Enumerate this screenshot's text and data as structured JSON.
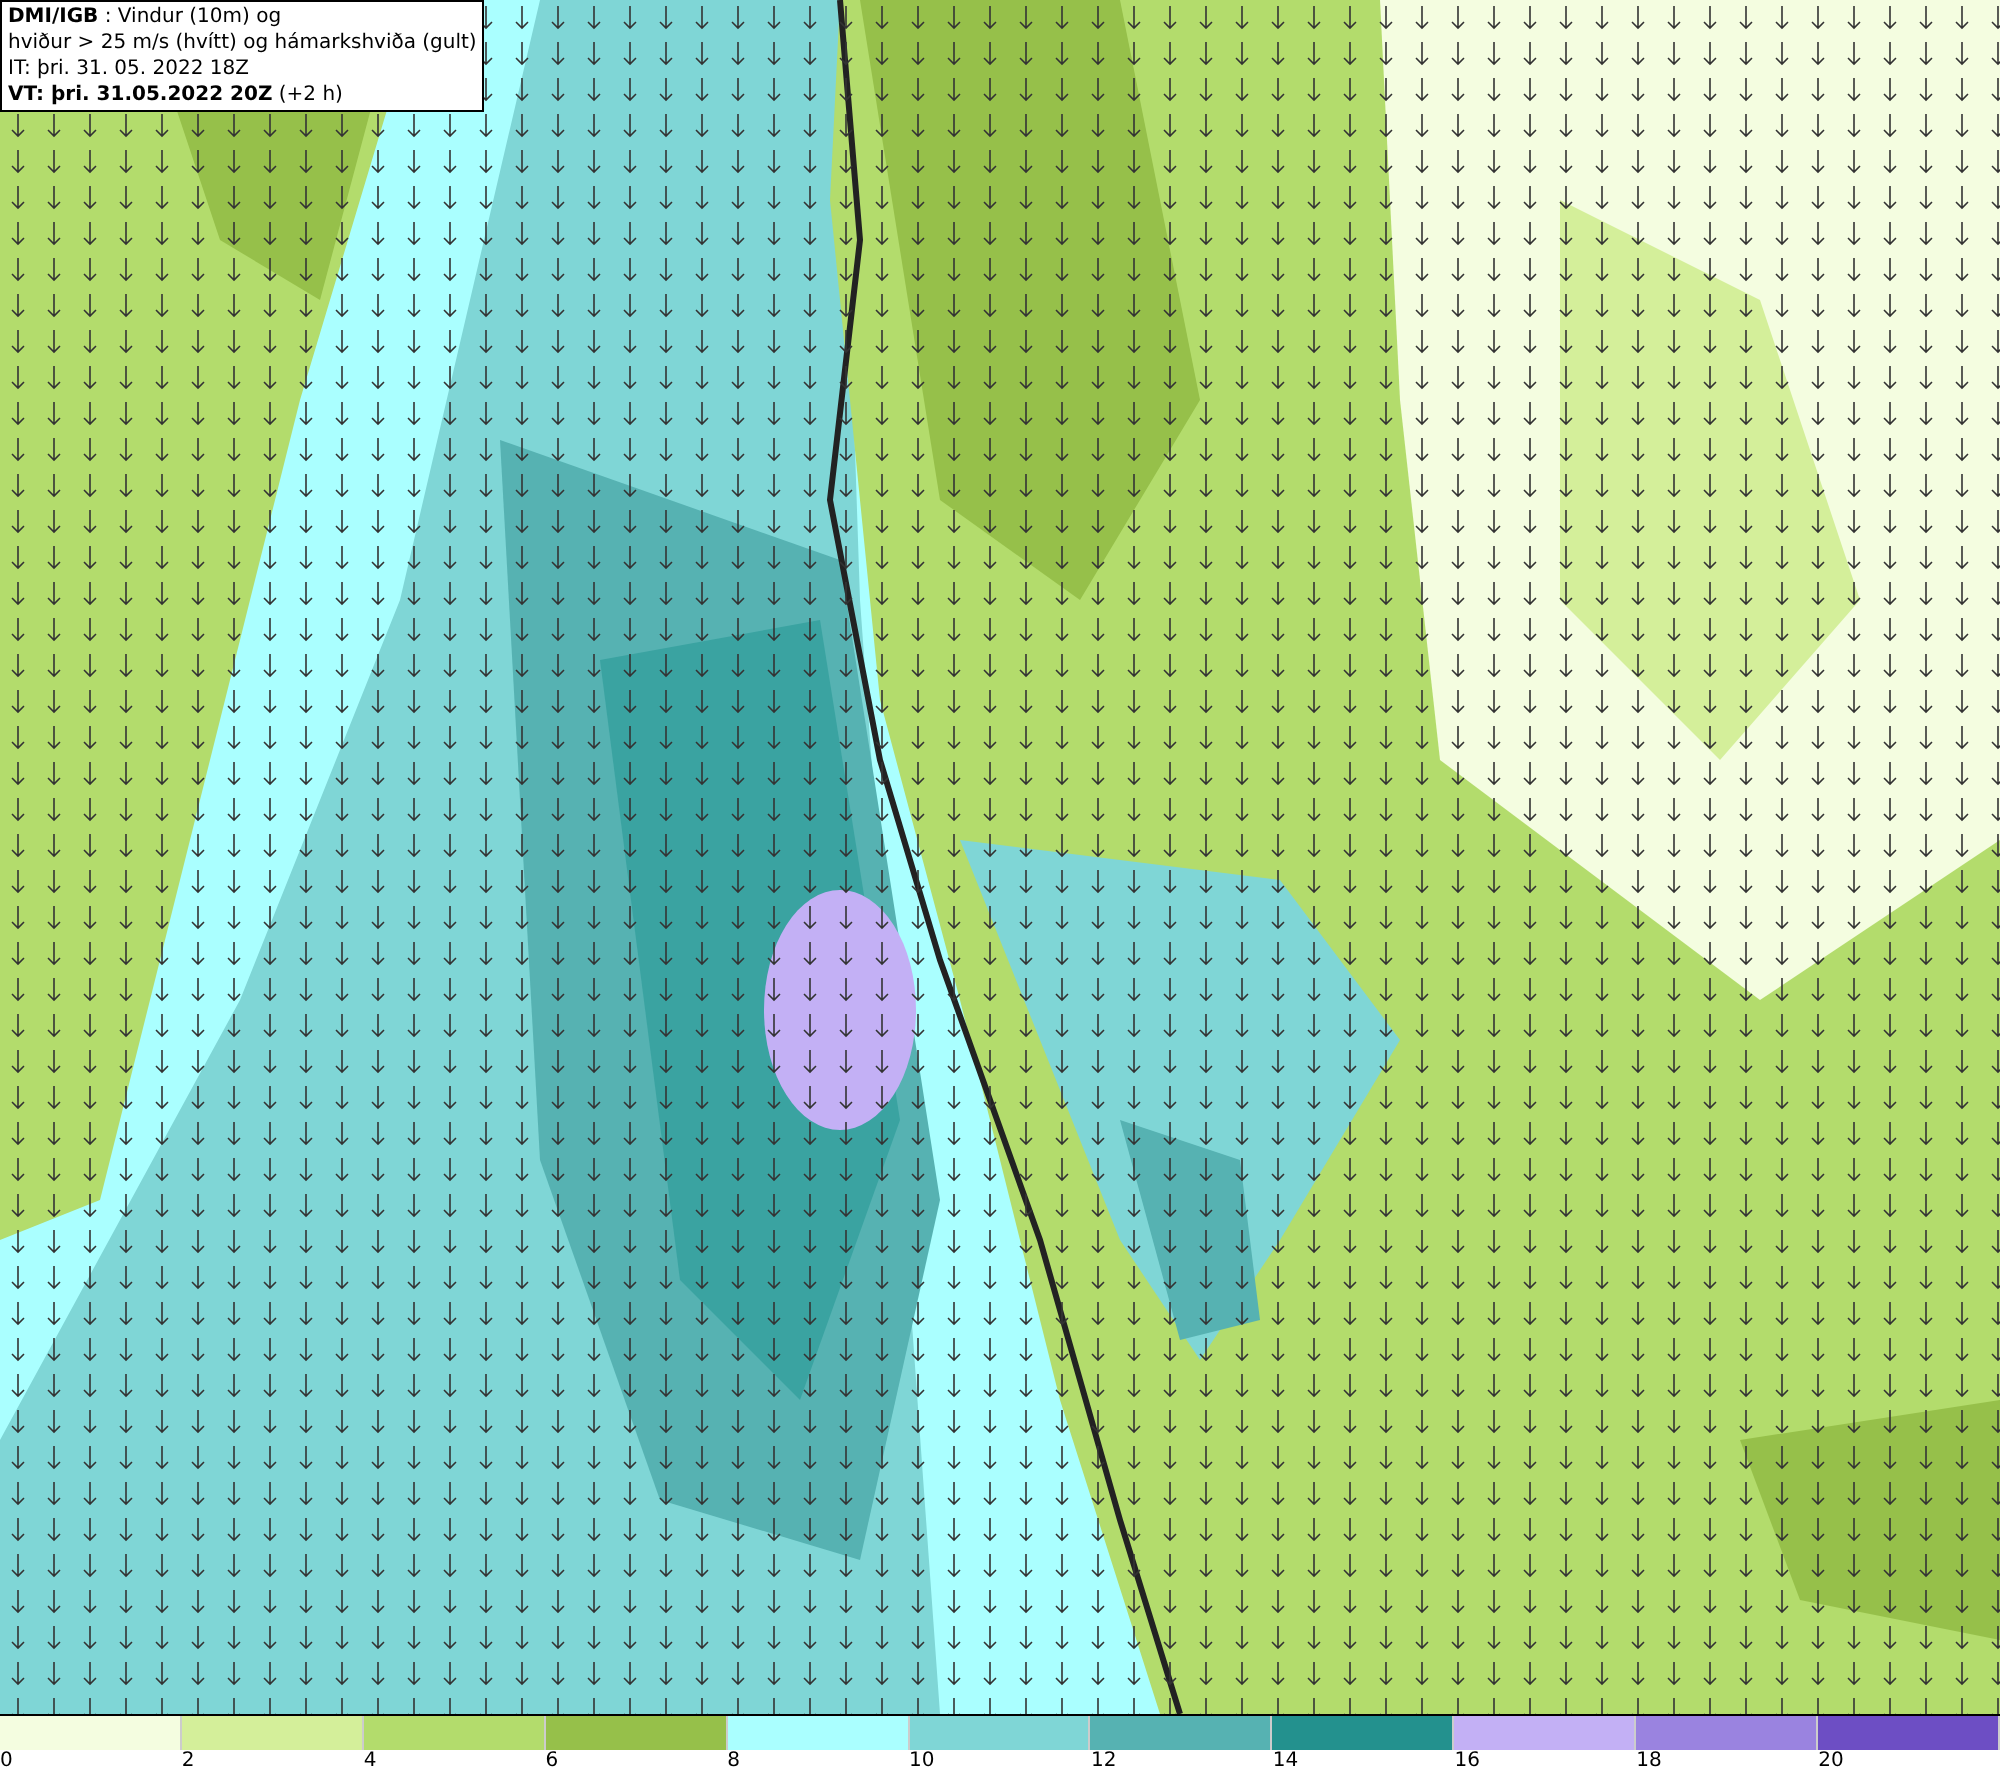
{
  "header": {
    "lines": [
      "**DMI/IGB** : Vindur (10m) og",
      "hviður > 25 m/s (hvítt) og hámarkshviða (gult)",
      "IT: þri. 31. 05. 2022 18Z",
      "**VT: þri. 31.05.2022 20Z** (+2 h)"
    ]
  },
  "legend": {
    "swatches": [
      {
        "color": "#f4fde0"
      },
      {
        "color": "#d4ef9a"
      },
      {
        "color": "#b3dc6c"
      },
      {
        "color": "#96c04a"
      },
      {
        "color": "#aaffff"
      },
      {
        "color": "#7fd6d6"
      },
      {
        "color": "#56b2b2"
      },
      {
        "color": "#23918e"
      },
      {
        "color": "#c3b0f5"
      },
      {
        "color": "#9a83e0"
      },
      {
        "color": "#6d4ec4"
      }
    ],
    "labels": [
      "0",
      "2",
      "4",
      "6",
      "8",
      "10",
      "12",
      "14",
      "16",
      "18",
      "20"
    ]
  }
}
